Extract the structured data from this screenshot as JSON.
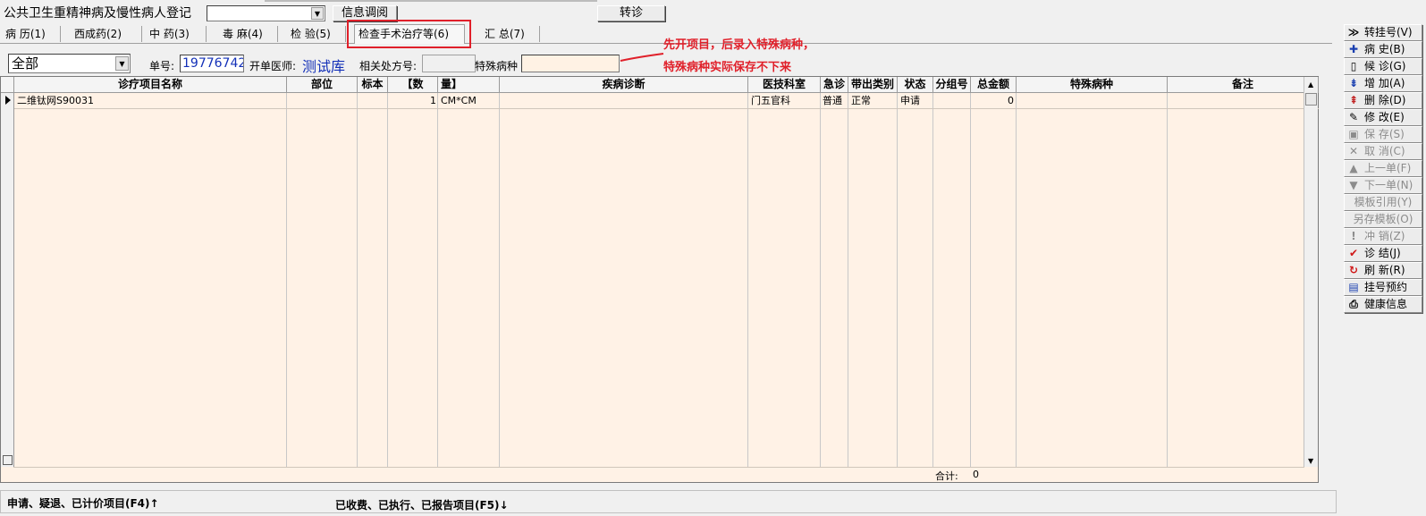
{
  "top": {
    "title": "公共卫生重精神病及慢性病人登记",
    "region_select_value": "",
    "info_button": "信息调阅",
    "transfer_button": "转诊"
  },
  "tabs": [
    {
      "label": "病 历(1)"
    },
    {
      "label": "西成药(2)"
    },
    {
      "label": "中 药(3)"
    },
    {
      "label": "毒 麻(4)"
    },
    {
      "label": "检 验(5)"
    },
    {
      "label": "检查手术治疗等(6)"
    },
    {
      "label": "汇 总(7)"
    }
  ],
  "filter": {
    "scope_value": "全部",
    "order_label": "单号:",
    "order_value": "19776742",
    "doctor_label": "开单医师:",
    "doctor_value": "测试库",
    "rx_label": "相关处方号:",
    "rx_value": "",
    "disease_label": "特殊病种",
    "disease_value": ""
  },
  "annotations": {
    "line1": "先开项目，后录入特殊病种，",
    "line2": "特殊病种实际保存不下来",
    "color": "#e0202a"
  },
  "grid": {
    "headers": [
      "诊疗项目名称",
      "部位",
      "标本",
      "【数",
      "量】",
      "疾病诊断",
      "医技科室",
      "急诊",
      "带出类别",
      "状态",
      "分组号",
      "总金额",
      "特殊病种",
      "备注"
    ],
    "rows": [
      {
        "name": "二维钛网S90031",
        "site": "",
        "specimen": "",
        "qty": "1",
        "unit": "CM*CM",
        "diagnosis": "",
        "dept": "门五官科",
        "urgent": "普通",
        "category": "正常",
        "status": "申请",
        "group": "",
        "amount": "0",
        "special": "",
        "note": ""
      }
    ],
    "total_label": "合计:",
    "total_value": "0",
    "background": "#fff2e6"
  },
  "bottom": {
    "left": "申请、疑退、已计价项目(F4)↑",
    "mid": "已收费、已执行、已报告项目(F5)↓"
  },
  "toolbar": [
    {
      "icon": "transfer-icon",
      "glyph": "≫",
      "label": "转挂号(V)",
      "enabled": true
    },
    {
      "icon": "plus-icon",
      "glyph": "✚",
      "label": "病 史(B)",
      "enabled": true
    },
    {
      "icon": "document-icon",
      "glyph": "▯",
      "label": "候 诊(G)",
      "enabled": true
    },
    {
      "icon": "add-list-icon",
      "glyph": "⇟",
      "label": "增 加(A)",
      "enabled": true
    },
    {
      "icon": "delete-list-icon",
      "glyph": "⇞",
      "label": "删 除(D)",
      "enabled": true
    },
    {
      "icon": "edit-icon",
      "glyph": "✎",
      "label": "修 改(E)",
      "enabled": true
    },
    {
      "icon": "save-icon",
      "glyph": "▣",
      "label": "保 存(S)",
      "enabled": false
    },
    {
      "icon": "cancel-icon",
      "glyph": "✕",
      "label": "取 消(C)",
      "enabled": false
    },
    {
      "icon": "prev-icon",
      "glyph": "▲",
      "label": "上一单(F)",
      "enabled": false
    },
    {
      "icon": "next-icon",
      "glyph": "▼",
      "label": "下一单(N)",
      "enabled": false
    },
    {
      "icon": "",
      "glyph": "",
      "label": "模板引用(Y)",
      "enabled": false
    },
    {
      "icon": "",
      "glyph": "",
      "label": "另存模板(O)",
      "enabled": false
    },
    {
      "icon": "reverse-icon",
      "glyph": "!",
      "label": "冲 销(Z)",
      "enabled": false
    },
    {
      "icon": "checkmark-icon",
      "glyph": "✔",
      "label": "诊 结(J)",
      "enabled": true
    },
    {
      "icon": "refresh-icon",
      "glyph": "↻",
      "label": "刷 新(R)",
      "enabled": true
    },
    {
      "icon": "appointment-icon",
      "glyph": "▤",
      "label": "挂号预约",
      "enabled": true
    },
    {
      "icon": "health-info-icon",
      "glyph": "⎙",
      "label": "健康信息",
      "enabled": true
    }
  ]
}
